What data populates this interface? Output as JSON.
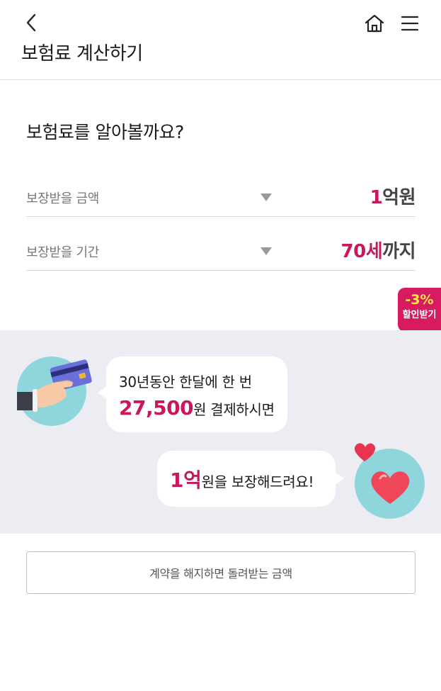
{
  "header": {
    "title": "보험료 계산하기",
    "back_icon": "chevron-left-icon",
    "home_icon": "home-icon",
    "menu_icon": "hamburger-menu-icon"
  },
  "calculator": {
    "question": "보험료를 알아볼까요?",
    "amount": {
      "label": "보장받을 금액",
      "value_number": "1",
      "value_unit": "억원"
    },
    "period": {
      "label": "보장받을 기간",
      "value_number": "70세",
      "value_unit": "까지"
    }
  },
  "discount_tab": {
    "percent": "-3%",
    "label": "할인받기"
  },
  "promo": {
    "bubble1": {
      "line1": "30년동안 한달에 한 번",
      "amount": "27,500",
      "amount_suffix": "원 결제하시면"
    },
    "bubble2": {
      "amount": "1억",
      "suffix": "원을 보장해드려요!"
    }
  },
  "refund_button": {
    "label": "계약을 해지하면 돌려받는 금액"
  },
  "colors": {
    "accent": "#c8175c",
    "discount_bg": "#d81b60",
    "discount_text": "#ffe44d",
    "promo_bg": "#ebedf2",
    "illustration_bg": "#8ed6dc"
  }
}
